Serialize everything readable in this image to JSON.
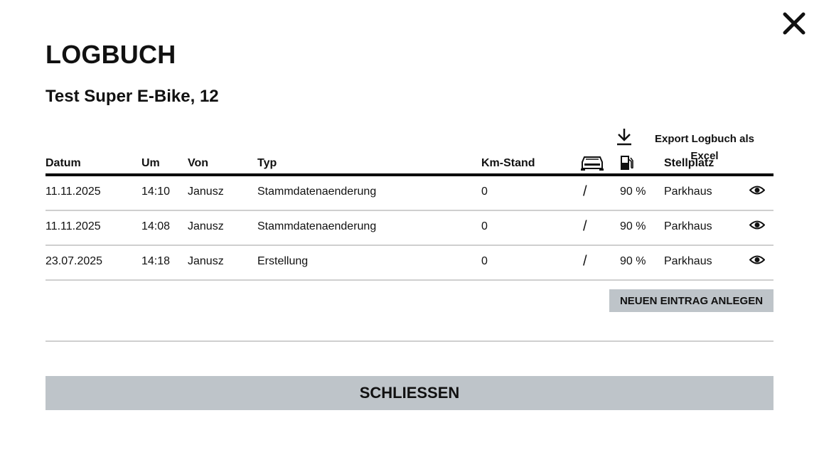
{
  "dialog": {
    "title": "LOGBUCH",
    "subtitle": "Test Super E-Bike, 12",
    "close_icon": "close-icon"
  },
  "export": {
    "label": "Export Logbuch als Excel",
    "icon": "download-icon"
  },
  "table": {
    "headers": {
      "datum": "Datum",
      "um": "Um",
      "von": "Von",
      "typ": "Typ",
      "km": "Km-Stand",
      "car_icon": "car-icon",
      "fuel_icon": "fuel-icon",
      "stellplatz": "Stellplatz"
    },
    "rows": [
      {
        "datum": "11.11.2025",
        "um": "14:10",
        "von": "Janusz",
        "typ": "Stammdatenaenderung",
        "km": "0",
        "car": "/",
        "fuel": "90 %",
        "stellplatz": "Parkhaus"
      },
      {
        "datum": "11.11.2025",
        "um": "14:08",
        "von": "Janusz",
        "typ": "Stammdatenaenderung",
        "km": "0",
        "car": "/",
        "fuel": "90 %",
        "stellplatz": "Parkhaus"
      },
      {
        "datum": "23.07.2025",
        "um": "14:18",
        "von": "Janusz",
        "typ": "Erstellung",
        "km": "0",
        "car": "/",
        "fuel": "90 %",
        "stellplatz": "Parkhaus"
      }
    ],
    "row_action_icon": "eye-icon"
  },
  "actions": {
    "new_entry": "NEUEN EINTRAG ANLEGEN",
    "close": "SCHLIESSEN"
  },
  "colors": {
    "button_bg": "#bec4c9",
    "text": "#111111",
    "row_border": "#cfcfcf"
  }
}
